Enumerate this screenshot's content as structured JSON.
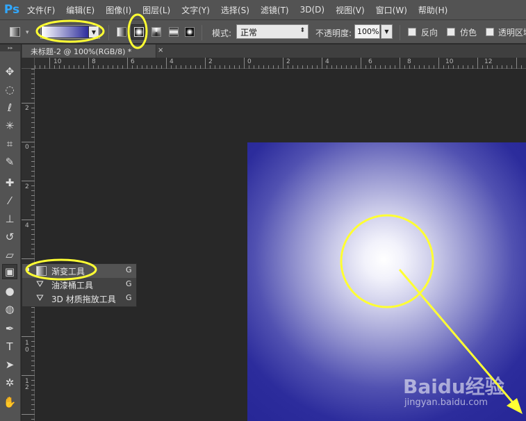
{
  "app": {
    "logo": "Ps"
  },
  "menubar": {
    "items": [
      "文件(F)",
      "编辑(E)",
      "图像(I)",
      "图层(L)",
      "文字(Y)",
      "选择(S)",
      "滤镜(T)",
      "3D(D)",
      "视图(V)",
      "窗口(W)",
      "帮助(H)"
    ]
  },
  "options": {
    "gradient_colors": [
      "#ffffff",
      "#2c2c9c"
    ],
    "gradient_types": [
      "linear-gradient-icon",
      "radial-gradient-icon",
      "angle-gradient-icon",
      "reflected-gradient-icon",
      "diamond-gradient-icon"
    ],
    "active_gradient_type": "radial",
    "mode_label": "模式:",
    "mode_value": "正常",
    "opacity_label": "不透明度:",
    "opacity_value": "100%",
    "reverse_label": "反向",
    "dither_label": "仿色",
    "transparency_label": "透明区域"
  },
  "document": {
    "tab_title": "未标题-2 @ 100%(RGB/8) *",
    "close_glyph": "×"
  },
  "ruler": {
    "horizontal": [
      "10",
      "8",
      "6",
      "4",
      "2",
      "0",
      "2",
      "4",
      "6",
      "8",
      "10",
      "12"
    ],
    "vertical": [
      "2",
      "0",
      "2",
      "4",
      "6",
      "8",
      "1 0",
      "1 2"
    ]
  },
  "canvas": {
    "gradient_center": "#ffffff",
    "gradient_edge": "#262696"
  },
  "flyout": {
    "items": [
      {
        "label": "渐变工具",
        "key": "G",
        "icon": "gradient-tool-icon",
        "selected": true
      },
      {
        "label": "油漆桶工具",
        "key": "G",
        "icon": "paint-bucket-icon",
        "selected": false
      },
      {
        "label": "3D 材质拖放工具",
        "key": "G",
        "icon": "3d-material-drop-icon",
        "selected": false
      }
    ]
  },
  "tools": [
    "move-tool-icon",
    "marquee-tool-icon",
    "lasso-tool-icon",
    "magic-wand-icon",
    "crop-tool-icon",
    "eyedropper-icon",
    "healing-brush-icon",
    "brush-tool-icon",
    "clone-stamp-icon",
    "history-brush-icon",
    "eraser-icon",
    "gradient-tool-icon",
    "blur-tool-icon",
    "dodge-tool-icon",
    "pen-tool-icon",
    "type-tool-icon",
    "path-selection-icon",
    "custom-shape-icon",
    "hand-tool-icon"
  ],
  "annotations": {
    "color": "#ffff33"
  },
  "watermark": {
    "logo": "Baidu经验",
    "url": "jingyan.baidu.com"
  }
}
